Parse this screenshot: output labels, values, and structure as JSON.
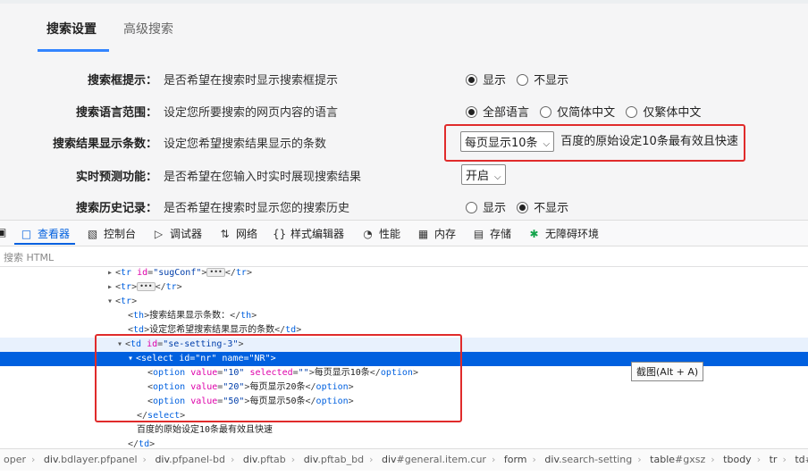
{
  "settings": {
    "tabs": [
      {
        "label": "搜索设置"
      },
      {
        "label": "高级搜索"
      }
    ],
    "rows": [
      {
        "label": "搜索框提示：",
        "desc": "是否希望在搜索时显示搜索框提示",
        "options": [
          "显示",
          "不显示"
        ],
        "selected": 0
      },
      {
        "label": "搜索语言范围：",
        "desc": "设定您所要搜索的网页内容的语言",
        "options": [
          "全部语言",
          "仅简体中文",
          "仅繁体中文"
        ],
        "selected": 0
      },
      {
        "label": "搜索结果显示条数：",
        "desc": "设定您希望搜索结果显示的条数",
        "select": "每页显示10条",
        "note": "百度的原始设定10条最有效且快速"
      },
      {
        "label": "实时预测功能：",
        "desc": "是否希望在您输入时实时展现搜索结果",
        "select": "开启"
      },
      {
        "label": "搜索历史记录：",
        "desc": "是否希望在搜索时显示您的搜索历史",
        "options": [
          "显示",
          "不显示"
        ],
        "selected": 1
      }
    ]
  },
  "devtools": {
    "tabs": [
      {
        "label": "查看器",
        "icon": "inspector-icon"
      },
      {
        "label": "控制台",
        "icon": "console-icon"
      },
      {
        "label": "调试器",
        "icon": "debugger-icon"
      },
      {
        "label": "网络",
        "icon": "network-icon"
      },
      {
        "label": "样式编辑器",
        "icon": "style-editor-icon"
      },
      {
        "label": "性能",
        "icon": "performance-icon"
      },
      {
        "label": "内存",
        "icon": "memory-icon"
      },
      {
        "label": "存储",
        "icon": "storage-icon"
      },
      {
        "label": "无障碍环境",
        "icon": "accessibility-icon"
      }
    ],
    "search_placeholder": "搜索 HTML",
    "tooltip": "截图(Alt + A)",
    "tree": {
      "tr_sugconf_id": "\"sugConf\"",
      "th_text": "搜索结果显示条数：",
      "td_text": "设定您希望搜索结果显示的条数",
      "td_id": "\"se-setting-3\"",
      "select_id": "\"nr\"",
      "select_name": "\"NR\"",
      "options": [
        {
          "value": "\"10\"",
          "selected": "\"\"",
          "text": "每页显示10条"
        },
        {
          "value": "\"20\"",
          "text": "每页显示20条"
        },
        {
          "value": "\"50\"",
          "text": "每页显示50条"
        }
      ],
      "after_text": "百度的原始设定10条最有效且快速"
    },
    "breadcrumbs": [
      {
        "tag": "",
        "cls": "oper"
      },
      {
        "tag": "div",
        ".cls": "",
        "cls": ".bdlayer.pfpanel"
      },
      {
        "tag": "div",
        "cls": ".pfpanel-bd"
      },
      {
        "tag": "div",
        "cls": ".pftab"
      },
      {
        "tag": "div",
        "cls": ".pftab_bd"
      },
      {
        "tag": "div",
        "cls": "#general.item.cur"
      },
      {
        "tag": "form",
        "cls": ""
      },
      {
        "tag": "div",
        "cls": ".search-setting"
      },
      {
        "tag": "table",
        "cls": "#gxsz"
      },
      {
        "tag": "tbody",
        "cls": ""
      },
      {
        "tag": "tr",
        "cls": ""
      },
      {
        "tag": "td",
        "cls": "#se-setti"
      }
    ]
  }
}
